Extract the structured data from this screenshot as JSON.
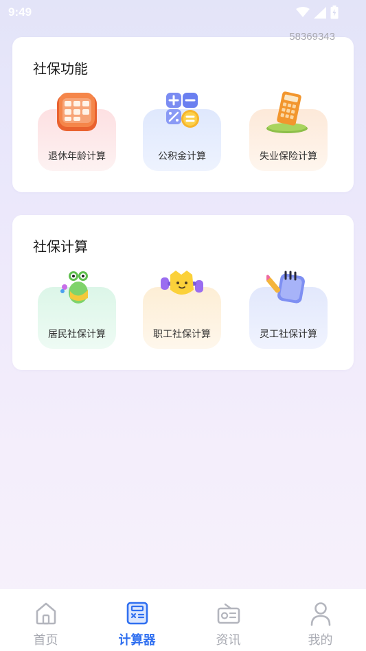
{
  "status_bar": {
    "time": "9:49"
  },
  "watermark": "58369343",
  "sections": [
    {
      "title": "社保功能",
      "items": [
        {
          "label": "退休年龄计算",
          "icon": "calendar-icon"
        },
        {
          "label": "公积金计算",
          "icon": "calculator-icon"
        },
        {
          "label": "失业保险计算",
          "icon": "desk-calculator-icon"
        }
      ]
    },
    {
      "title": "社保计算",
      "items": [
        {
          "label": "居民社保计算",
          "icon": "frog-mascot-icon"
        },
        {
          "label": "职工社保计算",
          "icon": "dumbbell-mascot-icon"
        },
        {
          "label": "灵工社保计算",
          "icon": "notepad-icon"
        }
      ]
    }
  ],
  "tabbar": {
    "items": [
      {
        "label": "首页",
        "icon": "home-icon",
        "active": false
      },
      {
        "label": "计算器",
        "icon": "calculator-tab-icon",
        "active": true
      },
      {
        "label": "资讯",
        "icon": "radio-icon",
        "active": false
      },
      {
        "label": "我的",
        "icon": "person-icon",
        "active": false
      }
    ],
    "active_color": "#2f6ff0",
    "inactive_color": "#a9abb3"
  }
}
